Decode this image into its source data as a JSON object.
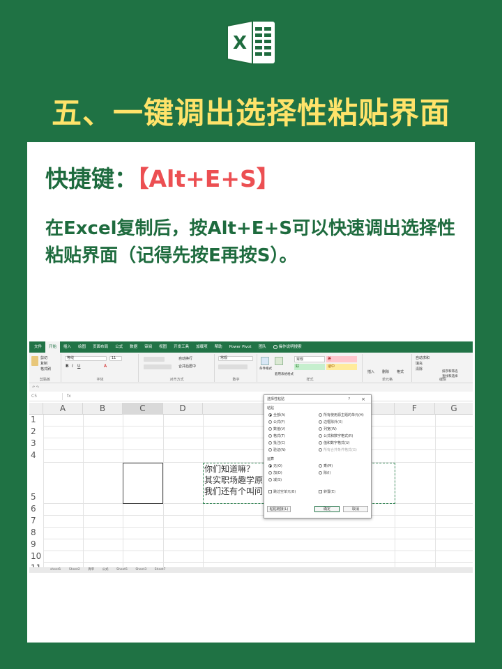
{
  "logo": {
    "letter": "X",
    "icon": "excel-logo-icon",
    "colors": {
      "dark": "#1e6b3e",
      "light": "#ffffff"
    }
  },
  "page_title": "五、一键调出选择性粘贴界面",
  "shortcut": {
    "label": "快捷键：",
    "keys": "【Alt+E+S】"
  },
  "description": "在Excel复制后，按Alt+E+S可以快速调出选择性粘贴界面（记得先按E再按S）。",
  "colors": {
    "background": "#1f7244",
    "title": "#ffe36a",
    "text": "#1e6b3e",
    "keys": "#ec4f52",
    "excel": "#217346"
  },
  "excel": {
    "ribbon_tabs": [
      "文件",
      "开始",
      "插入",
      "绘图",
      "页面布局",
      "公式",
      "数据",
      "审阅",
      "视图",
      "开发工具",
      "加载项",
      "帮助",
      "Power Pivot",
      "团队",
      "操作说明搜索"
    ],
    "active_tab": "开始",
    "ribbon_groups": [
      "剪贴板",
      "字体",
      "对齐方式",
      "数字",
      "样式",
      "单元格",
      "编辑"
    ],
    "clipboard": [
      "剪切",
      "复制",
      "格式刷"
    ],
    "font_name": "等线",
    "font_size": "11",
    "wrap_text": "自动换行",
    "merge_center": "合并后居中",
    "number_format": "常规",
    "style_cells": [
      "常规",
      "差",
      "好",
      "适中"
    ],
    "style_buttons": [
      "条件格式",
      "套用表格格式"
    ],
    "cell_buttons": [
      "插入",
      "删除",
      "格式"
    ],
    "edit_buttons": [
      "自动求和",
      "填充",
      "清除",
      "排序和筛选",
      "查找和选择"
    ],
    "name_box": "C5",
    "fx": "fx",
    "columns": [
      "A",
      "B",
      "C",
      "D",
      "E",
      "F",
      "G"
    ],
    "rows": [
      "1",
      "2",
      "3",
      "4",
      "5",
      "6",
      "7",
      "8",
      "9",
      "10",
      "11"
    ],
    "cell_lines": [
      "你们知道嘛？",
      "其实职场趣学原",
      "我们还有个叫问"
    ],
    "sheet_tabs": [
      "sheet1",
      "Sheet2",
      "清单",
      "公式",
      "Sheet5",
      "Sheet3",
      "Sheet7"
    ]
  },
  "dialog": {
    "title": "选择性粘贴",
    "help": "?",
    "close": "×",
    "paste_section": "粘贴",
    "paste_left": [
      "全部(A)",
      "公式(F)",
      "数值(V)",
      "格式(T)",
      "批注(C)",
      "验证(N)"
    ],
    "paste_right": [
      "所有使用源主题的单元(H)",
      "边框除外(X)",
      "列宽(W)",
      "公式和数字格式(R)",
      "值和数字格式(U)",
      "所有合并条件格式(G)"
    ],
    "operation_section": "运算",
    "op_left": [
      "无(O)",
      "加(D)",
      "减(S)"
    ],
    "op_right": [
      "乘(M)",
      "除(I)"
    ],
    "skip_blanks": "跳过空单元(B)",
    "transpose": "转置(E)",
    "paste_link": "粘贴链接(L)",
    "ok": "确定",
    "cancel": "取消"
  }
}
